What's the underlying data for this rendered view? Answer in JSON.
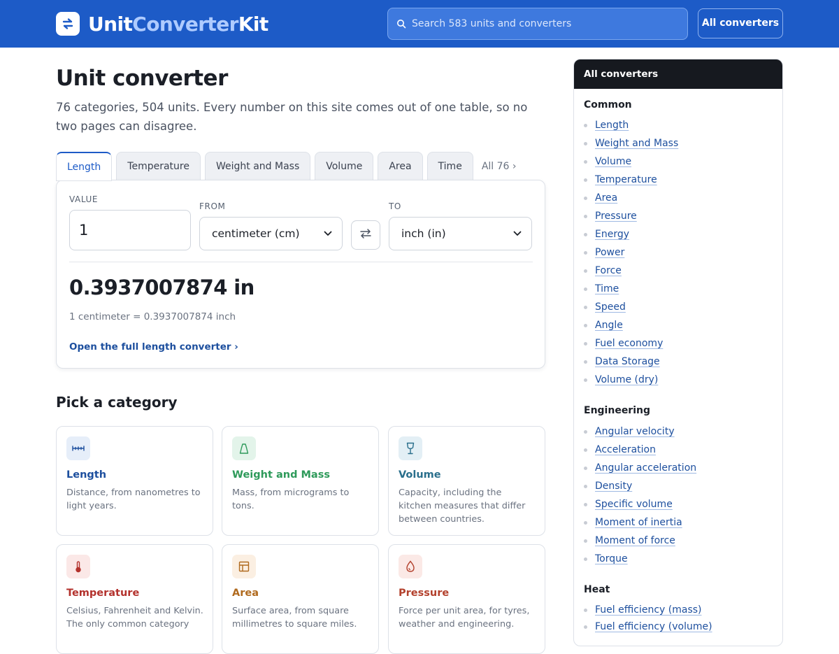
{
  "header": {
    "logo_part1": "Unit",
    "logo_part2": "Converter",
    "logo_part3": "Kit",
    "search_placeholder": "Search 583 units and converters",
    "all_converters_label": "All converters"
  },
  "main": {
    "title": "Unit converter",
    "subtitle": "76 categories, 504 units. Every number on this site comes out of one table, so no two pages can disagree.",
    "tabs": [
      {
        "label": "Length",
        "active": true
      },
      {
        "label": "Temperature",
        "active": false
      },
      {
        "label": "Weight and Mass",
        "active": false
      },
      {
        "label": "Volume",
        "active": false
      },
      {
        "label": "Area",
        "active": false
      },
      {
        "label": "Time",
        "active": false
      }
    ],
    "tabs_more": "All 76 ›",
    "converter": {
      "value_label": "VALUE",
      "value": "1",
      "from_label": "FROM",
      "from_unit": "centimeter (cm)",
      "to_label": "TO",
      "to_unit": "inch (in)",
      "result": "0.3937007874 in",
      "formula": "1 centimeter = 0.3937007874 inch",
      "open_link": "Open the full length converter ›"
    },
    "pick_title": "Pick a category",
    "categories": [
      {
        "title": "Length",
        "desc": "Distance, from nanometres to light years.",
        "color": "#1d4f9e",
        "icon": "ruler-icon"
      },
      {
        "title": "Weight and Mass",
        "desc": "Mass, from micrograms to tons.",
        "color": "#2e9a5a",
        "icon": "weight-icon"
      },
      {
        "title": "Volume",
        "desc": "Capacity, including the kitchen measures that differ between countries.",
        "color": "#2a6f8c",
        "icon": "glass-icon"
      },
      {
        "title": "Temperature",
        "desc": "Celsius, Fahrenheit and Kelvin. The only common category",
        "color": "#b3322d",
        "icon": "thermometer-icon"
      },
      {
        "title": "Area",
        "desc": "Surface area, from square millimetres to square miles.",
        "color": "#b06a1e",
        "icon": "area-icon"
      },
      {
        "title": "Pressure",
        "desc": "Force per unit area, for tyres, weather and engineering.",
        "color": "#b3412d",
        "icon": "drop-icon"
      }
    ]
  },
  "sidebar": {
    "title": "All converters",
    "groups": [
      {
        "name": "Common",
        "items": [
          "Length",
          "Weight and Mass",
          "Volume",
          "Temperature",
          "Area",
          "Pressure",
          "Energy",
          "Power",
          "Force",
          "Time",
          "Speed",
          "Angle",
          "Fuel economy",
          "Data Storage",
          "Volume (dry)"
        ]
      },
      {
        "name": "Engineering",
        "items": [
          "Angular velocity",
          "Acceleration",
          "Angular acceleration",
          "Density",
          "Specific volume",
          "Moment of inertia",
          "Moment of force",
          "Torque"
        ]
      },
      {
        "name": "Heat",
        "items": [
          "Fuel efficiency (mass)",
          "Fuel efficiency (volume)"
        ]
      }
    ]
  },
  "colors": {
    "header_bg": "#1d5bc7",
    "accent": "#1d5bc7",
    "link": "#1d4f9e",
    "sidebar_head_bg": "#16191f"
  }
}
